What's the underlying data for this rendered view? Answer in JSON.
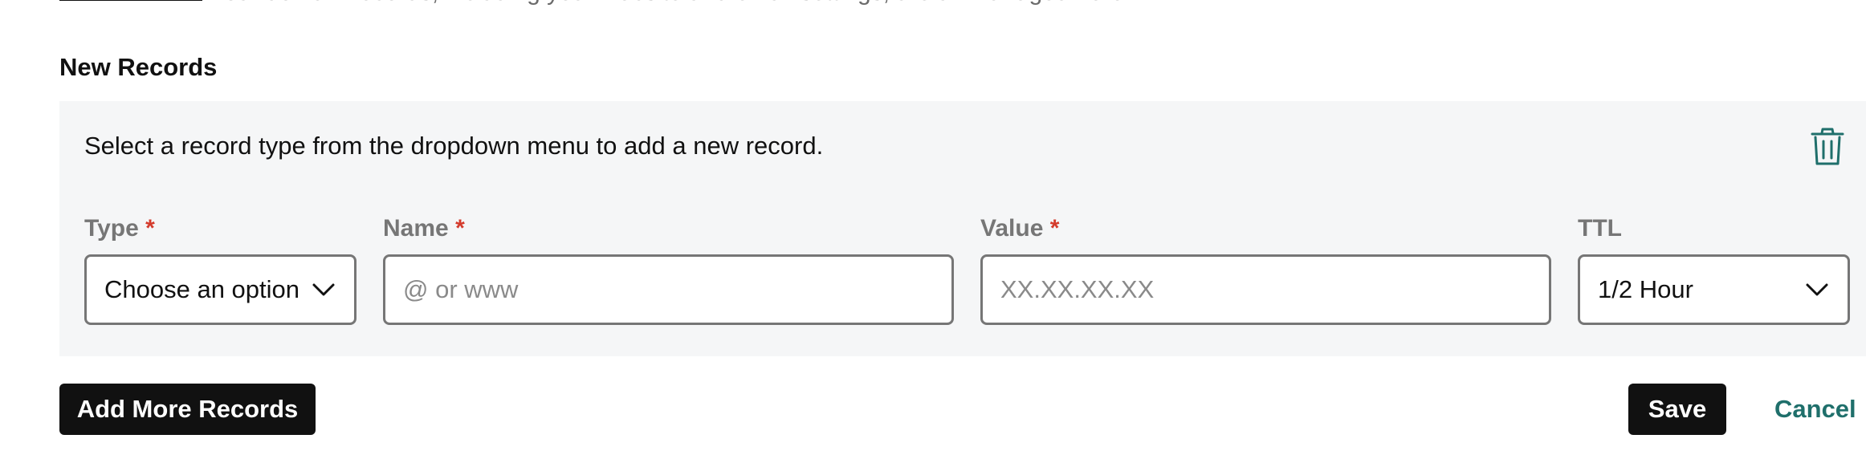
{
  "header": {
    "cut_off_text": "Your domain records, including your website and email settings, are all managed here."
  },
  "new_records": {
    "title": "New Records",
    "instructions": "Select a record type from the dropdown menu to add a new record.",
    "required_marker": "*",
    "type_field": {
      "label": "Type",
      "value": "Choose an option",
      "required": true
    },
    "name_field": {
      "label": "Name",
      "placeholder": "@ or www",
      "value": "",
      "required": true
    },
    "value_field": {
      "label": "Value",
      "placeholder": "XX.XX.XX.XX",
      "value": "",
      "required": true
    },
    "ttl_field": {
      "label": "TTL",
      "value": "1/2 Hour",
      "required": false
    }
  },
  "actions": {
    "add_more_label": "Add More Records",
    "save_label": "Save",
    "cancel_label": "Cancel"
  },
  "colors": {
    "panel_bg": "#f5f6f7",
    "required_red": "#d43b2c",
    "link_teal": "#1f6f6b",
    "button_dark": "#111111"
  },
  "icons": {
    "delete": "trash-icon",
    "dropdown": "chevron-down-icon"
  }
}
